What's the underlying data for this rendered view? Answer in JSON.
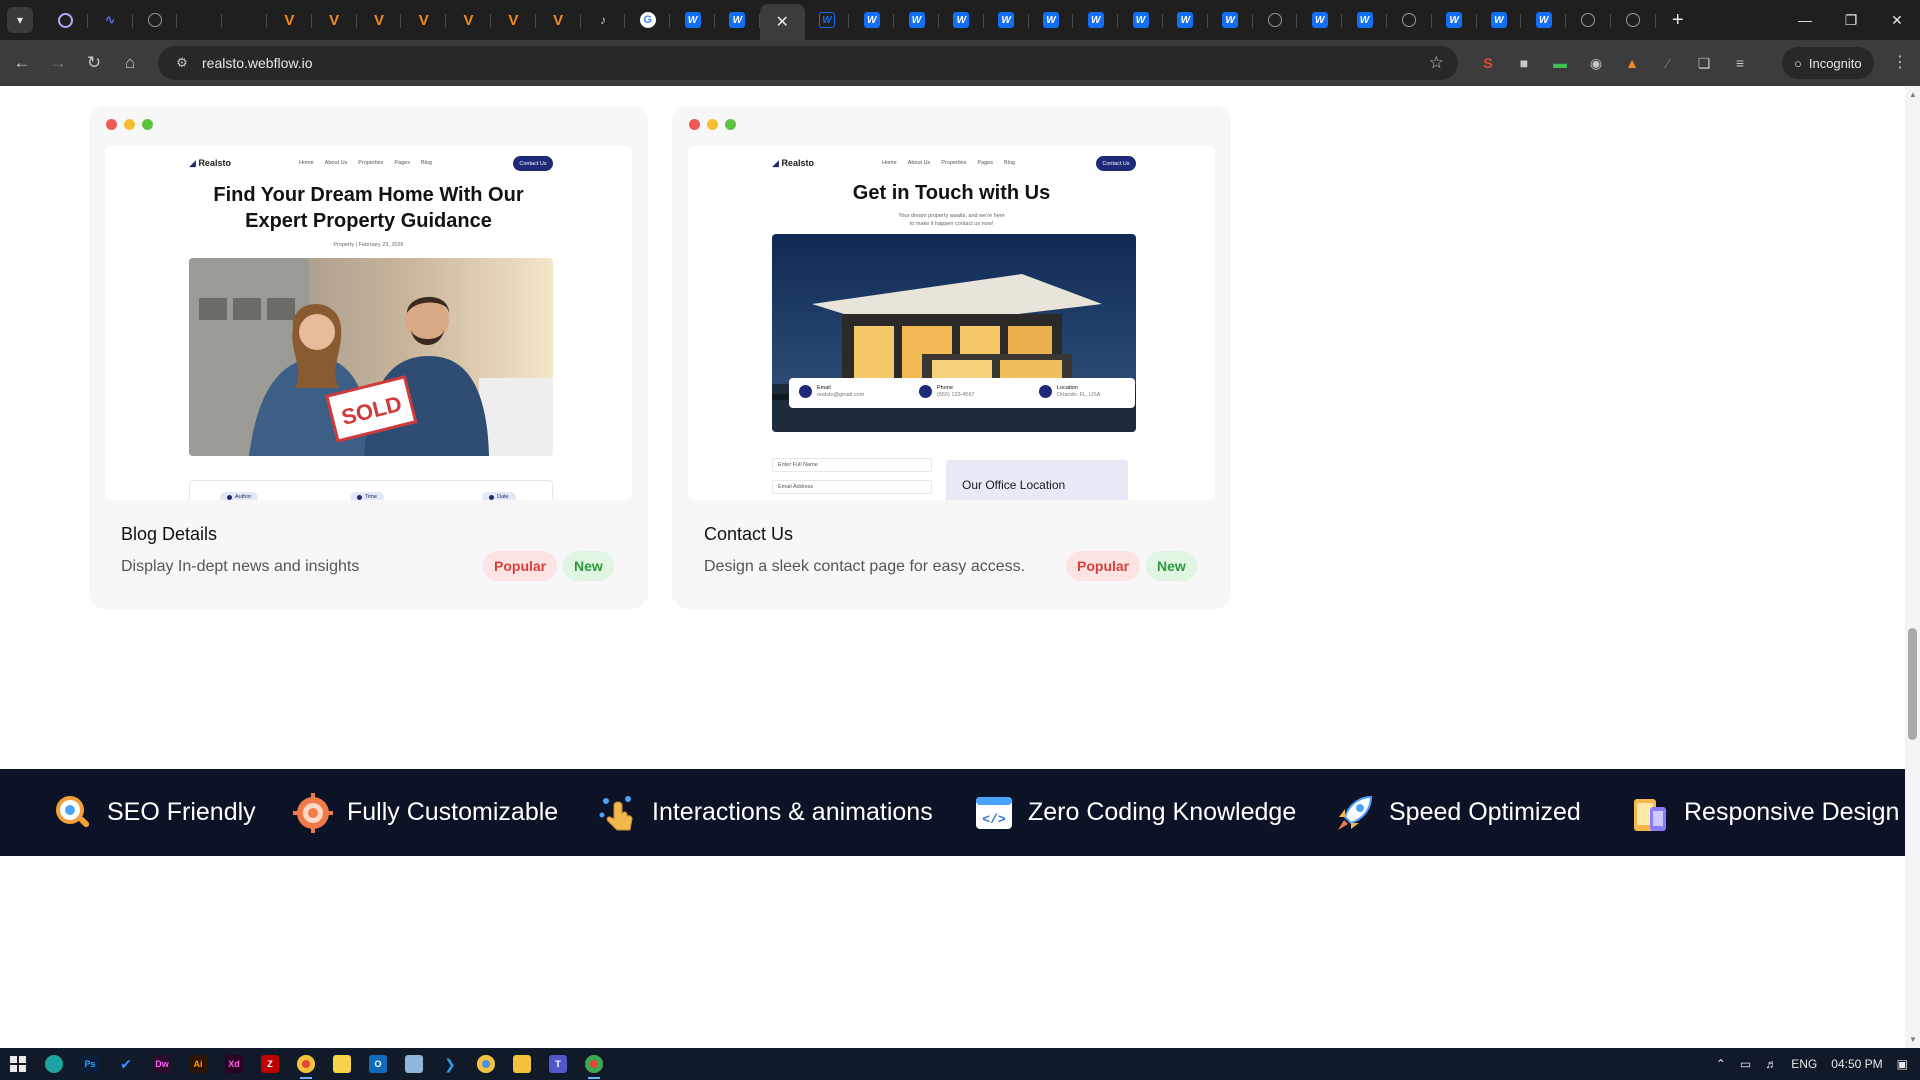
{
  "browser": {
    "url": "realsto.webflow.io",
    "incognito_label": "Incognito",
    "tabs": [
      {
        "icon": "ring-icon"
      },
      {
        "icon": "wave-icon"
      },
      {
        "icon": "globe-icon"
      },
      {
        "icon": "blank-icon"
      },
      {
        "icon": "blank-icon"
      },
      {
        "icon": "v-logo-icon"
      },
      {
        "icon": "v-logo-icon"
      },
      {
        "icon": "v-logo-icon"
      },
      {
        "icon": "v-logo-icon"
      },
      {
        "icon": "v-logo-icon"
      },
      {
        "icon": "v-logo-icon"
      },
      {
        "icon": "v-logo-icon"
      },
      {
        "icon": "speaker-icon"
      },
      {
        "icon": "google-icon"
      },
      {
        "icon": "webflow-icon"
      },
      {
        "icon": "webflow-icon"
      },
      {
        "icon": "close-icon",
        "active": true
      },
      {
        "icon": "webflow-outline-icon"
      },
      {
        "icon": "webflow-icon"
      },
      {
        "icon": "webflow-icon"
      },
      {
        "icon": "webflow-icon"
      },
      {
        "icon": "webflow-icon"
      },
      {
        "icon": "webflow-icon"
      },
      {
        "icon": "webflow-icon"
      },
      {
        "icon": "webflow-icon"
      },
      {
        "icon": "webflow-icon"
      },
      {
        "icon": "webflow-icon"
      },
      {
        "icon": "globe-icon"
      },
      {
        "icon": "webflow-icon"
      },
      {
        "icon": "webflow-icon"
      },
      {
        "icon": "globe-icon"
      },
      {
        "icon": "webflow-icon"
      },
      {
        "icon": "webflow-icon"
      },
      {
        "icon": "webflow-icon"
      },
      {
        "icon": "globe-icon"
      },
      {
        "icon": "globe-icon"
      }
    ]
  },
  "cards": [
    {
      "title": "Blog Details",
      "description": "Display In-dept news and insights",
      "badges": [
        "Popular",
        "New"
      ],
      "preview": {
        "logo": "Realsto",
        "nav": [
          "Home",
          "About Us",
          "Properties",
          "Pages",
          "Blog"
        ],
        "cta": "Contact Us",
        "heading_line1": "Find Your Dream Home With Our",
        "heading_line2": "Expert Property Guidance",
        "meta": "Property | February 23, 2026",
        "pills": [
          "Author",
          "Time",
          "Date"
        ],
        "photo_sign": "SOLD"
      }
    },
    {
      "title": "Contact Us",
      "description": "Design a sleek contact page for easy access.",
      "badges": [
        "Popular",
        "New"
      ],
      "preview": {
        "logo": "Realsto",
        "nav": [
          "Home",
          "About Us",
          "Properties",
          "Pages",
          "Blog"
        ],
        "cta": "Contact Us",
        "heading": "Get in Touch with Us",
        "sub_line1": "Your dream property awaits, and we're here",
        "sub_line2": "to make it happen contact us now!",
        "contacts": [
          {
            "label": "Email",
            "value": "realsto@gmail.com"
          },
          {
            "label": "Phone",
            "value": "(555) 123-4567"
          },
          {
            "label": "Location",
            "value": "Orlando, FL, USA"
          }
        ],
        "field_name": "Enter Full Name",
        "field_email": "Email Address",
        "office_title": "Our Office Location"
      }
    }
  ],
  "features": [
    "SEO Friendly",
    "Fully Customizable",
    "Interactions & animations",
    "Zero Coding Knowledge",
    "Speed Optimized",
    "Responsive Design"
  ],
  "taskbar": {
    "apps": [
      "windows-start-icon",
      "edge-icon",
      "photoshop-icon",
      "todo-icon",
      "dreamweaver-icon",
      "illustrator-icon",
      "xd-icon",
      "filezilla-icon",
      "chrome-icon",
      "sticky-notes-icon",
      "outlook-icon",
      "notepad-icon",
      "vscode-icon",
      "chrome-icon",
      "file-explorer-icon",
      "teams-icon",
      "chrome-icon"
    ],
    "language": "ENG",
    "time": "04:50 PM"
  }
}
